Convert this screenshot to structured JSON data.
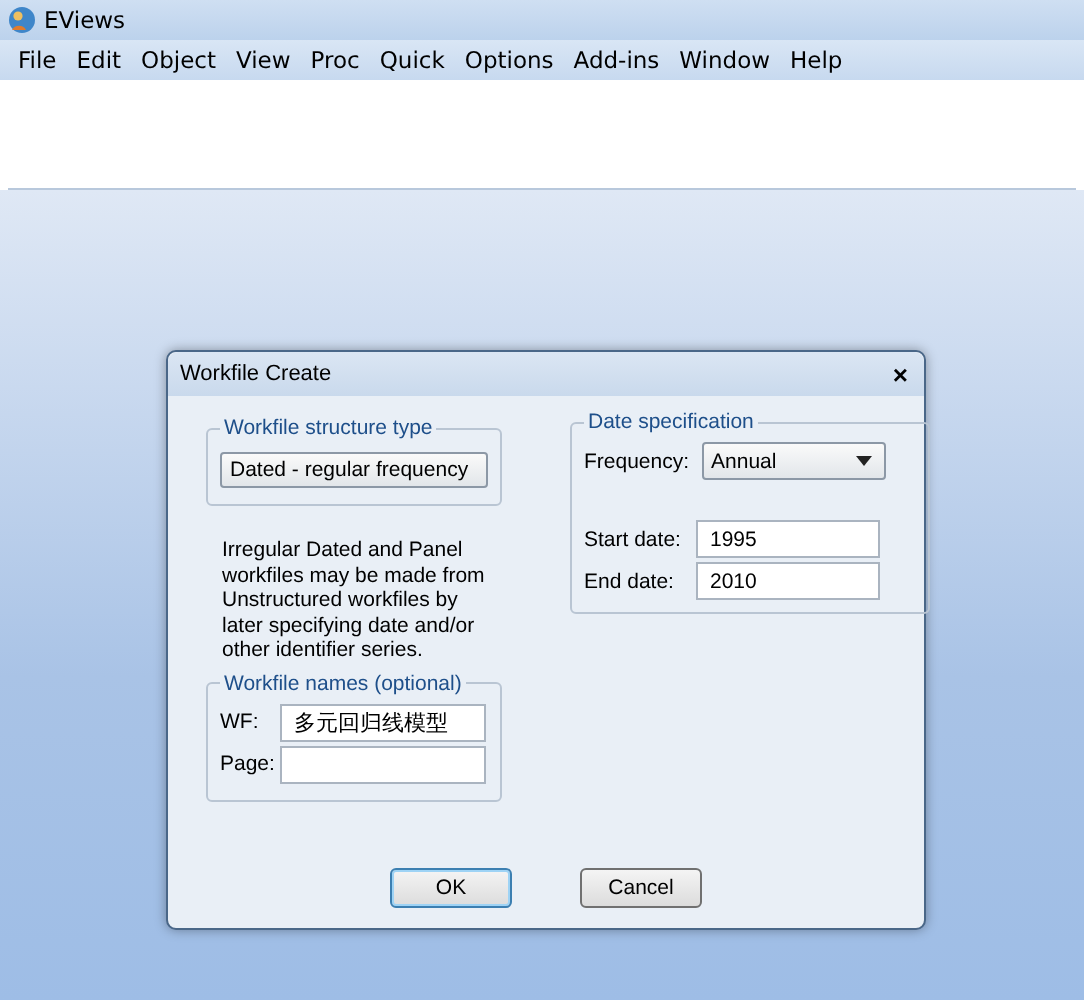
{
  "window": {
    "title": "EViews"
  },
  "menu": [
    "File",
    "Edit",
    "Object",
    "View",
    "Proc",
    "Quick",
    "Options",
    "Add-ins",
    "Window",
    "Help"
  ],
  "dialog": {
    "title": "Workfile Create",
    "close": "×",
    "structure": {
      "legend": "Workfile structure type",
      "value": "Dated - regular frequency",
      "note": "Irregular Dated and Panel workfiles may be made from Unstructured workfiles by later specifying date and/or other identifier series."
    },
    "date_spec": {
      "legend": "Date specification",
      "frequency_label": "Frequency:",
      "frequency": "Annual",
      "start_label": "Start date:",
      "start": "1995",
      "end_label": "End date:",
      "end": "2010"
    },
    "names": {
      "legend": "Workfile names (optional)",
      "wf_label": "WF:",
      "wf": "多元回归线模型",
      "page_label": "Page:"
    },
    "buttons": [
      {
        "label": "OK",
        "default": true
      },
      {
        "label": "Cancel",
        "default": false
      }
    ]
  }
}
